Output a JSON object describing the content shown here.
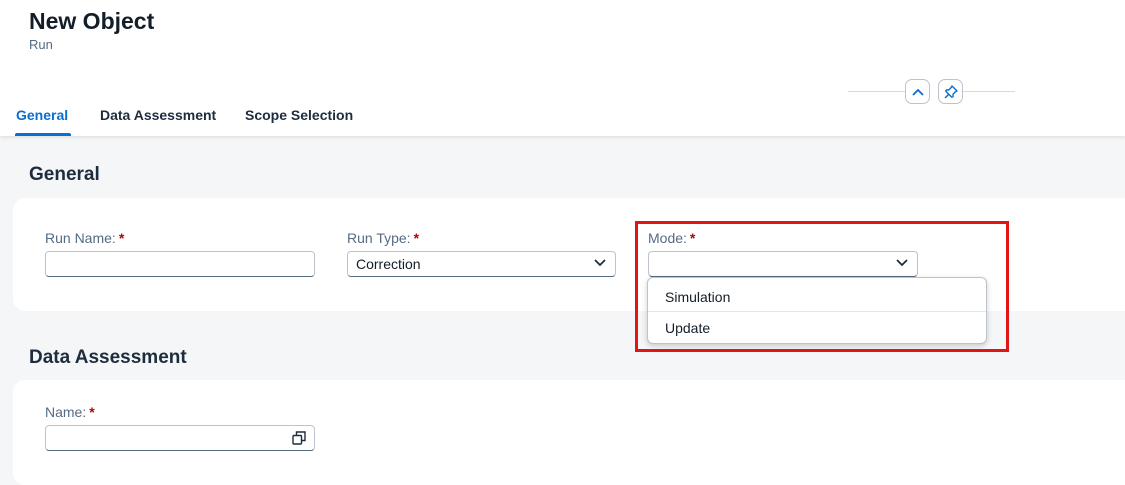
{
  "header": {
    "title": "New Object",
    "subtitle": "Run"
  },
  "tabs": [
    {
      "label": "General",
      "active": true
    },
    {
      "label": "Data Assessment",
      "active": false
    },
    {
      "label": "Scope Selection",
      "active": false
    }
  ],
  "general": {
    "title": "General",
    "run_name": {
      "label": "Run Name:",
      "value": ""
    },
    "run_type": {
      "label": "Run Type:",
      "value": "Correction"
    },
    "mode": {
      "label": "Mode:",
      "value": "",
      "options": [
        "Simulation",
        "Update"
      ]
    }
  },
  "data_assessment": {
    "title": "Data Assessment",
    "name": {
      "label": "Name:",
      "value": ""
    }
  },
  "required_marker": "*",
  "icons": {
    "collapse": "chevron-up-icon",
    "pin": "pin-icon",
    "dropdown": "chevron-down-icon",
    "value_help": "value-help-icon"
  },
  "colors": {
    "accent": "#0a6ed1",
    "required": "#aa0808",
    "highlight": "#e01515"
  }
}
